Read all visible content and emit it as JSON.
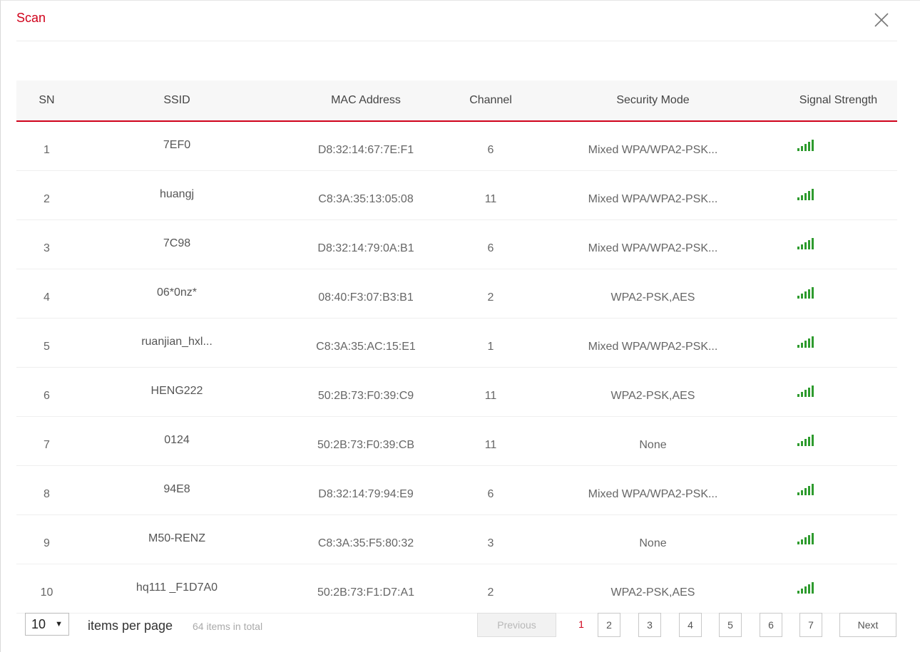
{
  "dialog": {
    "title": "Scan"
  },
  "table": {
    "headers": [
      "SN",
      "SSID",
      "MAC Address",
      "Channel",
      "Security Mode",
      "Signal Strength"
    ],
    "signal_color": "#2e9b2e",
    "accent_color": "#d0021b",
    "rows": [
      {
        "sn": "1",
        "ssid": "7EF0",
        "mac": "D8:32:14:67:7E:F1",
        "channel": "6",
        "security": "Mixed WPA/WPA2-PSK..."
      },
      {
        "sn": "2",
        "ssid": "huangj",
        "mac": "C8:3A:35:13:05:08",
        "channel": "11",
        "security": "Mixed WPA/WPA2-PSK..."
      },
      {
        "sn": "3",
        "ssid": "7C98",
        "mac": "D8:32:14:79:0A:B1",
        "channel": "6",
        "security": "Mixed WPA/WPA2-PSK..."
      },
      {
        "sn": "4",
        "ssid": "06*0nz*",
        "mac": "08:40:F3:07:B3:B1",
        "channel": "2",
        "security": "WPA2-PSK,AES"
      },
      {
        "sn": "5",
        "ssid": "ruanjian_hxl...",
        "mac": "C8:3A:35:AC:15:E1",
        "channel": "1",
        "security": "Mixed WPA/WPA2-PSK..."
      },
      {
        "sn": "6",
        "ssid": "HENG222",
        "mac": "50:2B:73:F0:39:C9",
        "channel": "11",
        "security": "WPA2-PSK,AES"
      },
      {
        "sn": "7",
        "ssid": "0124",
        "mac": "50:2B:73:F0:39:CB",
        "channel": "11",
        "security": "None"
      },
      {
        "sn": "8",
        "ssid": "94E8",
        "mac": "D8:32:14:79:94:E9",
        "channel": "6",
        "security": "Mixed WPA/WPA2-PSK..."
      },
      {
        "sn": "9",
        "ssid": "M50-RENZ",
        "mac": "C8:3A:35:F5:80:32",
        "channel": "3",
        "security": "None"
      },
      {
        "sn": "10",
        "ssid": "hq111 _F1D7A0",
        "mac": "50:2B:73:F1:D7:A1",
        "channel": "2",
        "security": "WPA2-PSK,AES"
      }
    ]
  },
  "pagination": {
    "per_page_value": "10",
    "per_page_label": "items per page",
    "total_label": "64 items in total",
    "previous_label": "Previous",
    "current_page": "1",
    "pages": [
      "2",
      "3",
      "4",
      "5",
      "6",
      "7"
    ],
    "next_label": "Next"
  }
}
